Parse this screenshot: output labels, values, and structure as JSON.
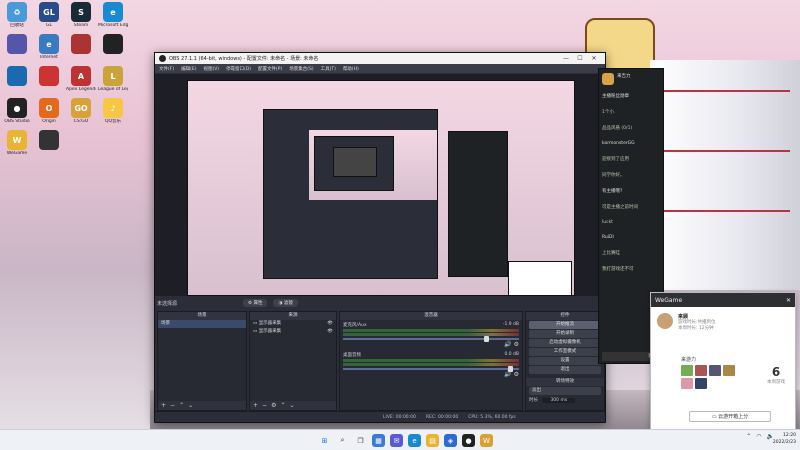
{
  "desktop": {
    "icons": [
      {
        "label": "回收站",
        "name": "recycle-bin",
        "color": "#4a9ad9",
        "glyph": "♻"
      },
      {
        "label": "GL",
        "name": "gl-app",
        "color": "#2a4a8a",
        "glyph": "GL"
      },
      {
        "label": "Steam",
        "name": "steam",
        "color": "#1b2838",
        "glyph": "S"
      },
      {
        "label": "Microsoft Edge",
        "name": "edge",
        "color": "#1a8ad0",
        "glyph": "e"
      },
      {
        "label": "",
        "name": "app-5",
        "color": "#55a",
        "glyph": ""
      },
      {
        "label": "Internet",
        "name": "internet",
        "color": "#3a7ac0",
        "glyph": "e"
      },
      {
        "label": "",
        "name": "app-7",
        "color": "#a33",
        "glyph": ""
      },
      {
        "label": "",
        "name": "app-8",
        "color": "#222",
        "glyph": ""
      },
      {
        "label": "",
        "name": "app-9",
        "color": "#1a6ab0",
        "glyph": ""
      },
      {
        "label": "",
        "name": "app-10",
        "color": "#c33",
        "glyph": ""
      },
      {
        "label": "Apex Legends",
        "name": "apex",
        "color": "#b33",
        "glyph": "A"
      },
      {
        "label": "League of Legends",
        "name": "lol",
        "color": "#c9a43a",
        "glyph": "L"
      },
      {
        "label": "OBS Studio",
        "name": "obs-studio",
        "color": "#222",
        "glyph": "●"
      },
      {
        "label": "Origin",
        "name": "origin",
        "color": "#e46a1a",
        "glyph": "O"
      },
      {
        "label": "CS:GO",
        "name": "csgo",
        "color": "#d9a13a",
        "glyph": "GO"
      },
      {
        "label": "QQ音乐",
        "name": "qq-music",
        "color": "#f7c744",
        "glyph": "♪"
      },
      {
        "label": "WeGame",
        "name": "wegame",
        "color": "#e9b431",
        "glyph": "W"
      },
      {
        "label": "",
        "name": "app-18",
        "color": "#333",
        "glyph": ""
      }
    ]
  },
  "obs": {
    "title": "OBS 27.1.1 (64-bit, windows) - 配置文件: 未命名 - 场景: 未命名",
    "menu": [
      "文件(F)",
      "编辑(E)",
      "视图(V)",
      "停靠窗口(D)",
      "配置文件(P)",
      "场景集合(S)",
      "工具(T)",
      "帮助(H)"
    ],
    "status_line": "未选择源",
    "tool_properties": "属性",
    "tool_filters": "滤镜",
    "docks": {
      "scenes": {
        "title": "场景",
        "items": [
          "场景"
        ]
      },
      "sources": {
        "title": "来源",
        "items": [
          "显示器采集",
          "显示器采集"
        ]
      },
      "mixer": {
        "title": "混音器",
        "tracks": [
          {
            "name": "麦克风/Aux",
            "level": "-1.9 dB"
          },
          {
            "name": "桌面音频",
            "level": "0.0 dB"
          }
        ]
      },
      "controls": {
        "title": "控件",
        "buttons": [
          "开始推流",
          "开始录制",
          "启动虚拟摄像机",
          "工作室模式",
          "设置",
          "退出"
        ]
      },
      "transitions": {
        "title": "转场特效",
        "type": "淡出",
        "duration_label": "时长",
        "duration": "300 ms"
      }
    },
    "status": {
      "live": "LIVE: 00:00:00",
      "rec": "REC: 00:00:00",
      "cpu": "CPU: 5.3%, 60.00 fps"
    }
  },
  "chat": {
    "header": "来吉力",
    "lines": [
      "主播粉丝勋章",
      "1个小.",
      "品品风悬 (0/1)",
      "kormonsterGG",
      "迎接到了应用",
      "同学你好。",
      "有主播哦?",
      "可是主播之前时间",
      "luckt",
      "RuiDl",
      "上比赛哇",
      "我打游戏还不可"
    ],
    "bottom": "发送"
  },
  "wegame": {
    "brand": "WeGame",
    "user": {
      "name": "来顾",
      "sub1": "游戏时长:共播到位",
      "sub2": "本周时长: 12分钟"
    },
    "section": "来游力",
    "count": "6",
    "count_label": "本周游戏",
    "button": "云游开箱上分"
  },
  "taskbar": {
    "time": "12:20",
    "date": "2022/2/23",
    "icons": [
      "start",
      "search",
      "task-view",
      "widgets",
      "chat",
      "edge",
      "explorer",
      "store",
      "obs",
      "wegame"
    ]
  }
}
